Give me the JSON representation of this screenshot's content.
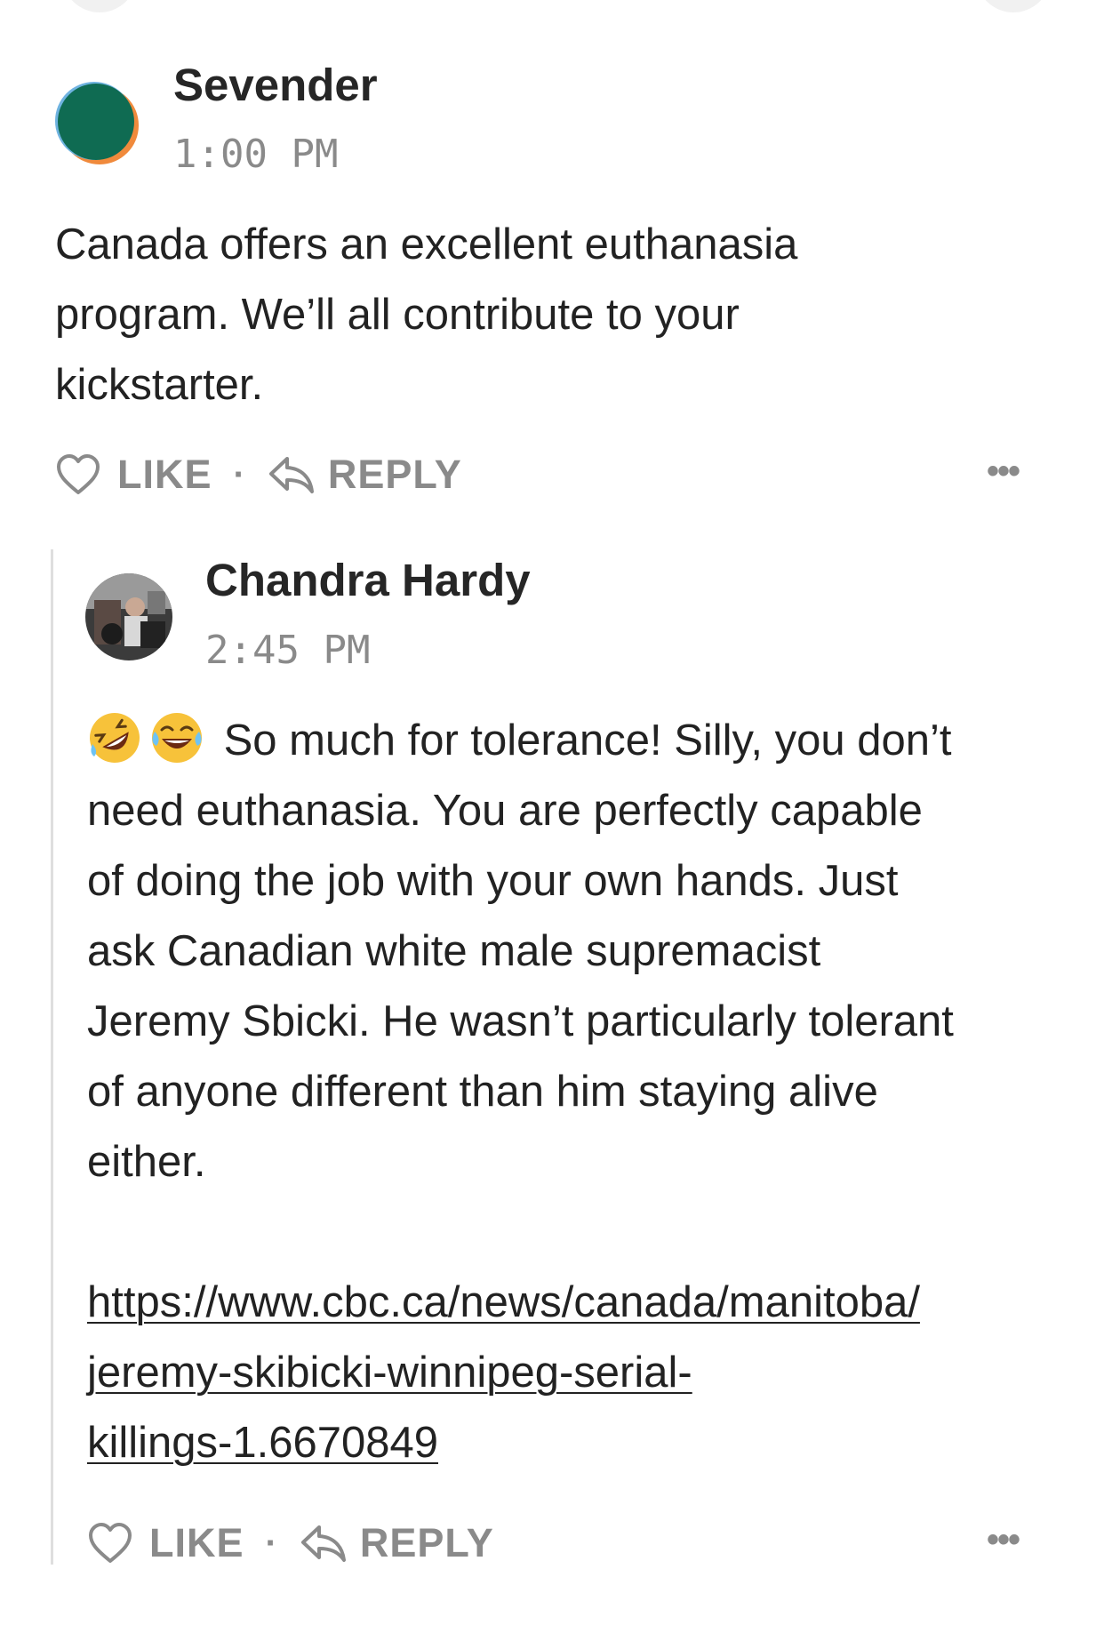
{
  "comments": [
    {
      "author": "Sevender",
      "time": "1:00 PM",
      "body_lines": [
        "Canada offers an excellent euthanasia",
        "program. We’ll all contribute to your",
        "kickstarter."
      ],
      "like_label": "LIKE",
      "reply_label": "REPLY",
      "more_label": "•••"
    },
    {
      "author": "Chandra Hardy",
      "time": "2:45 PM",
      "emoji_names": [
        "rolling-on-floor-laughing-emoji",
        "tears-of-joy-emoji"
      ],
      "body_lines": [
        "So much for tolerance! Silly, you don’t",
        "need euthanasia. You are perfectly capable",
        "of doing the job with your own hands. Just",
        "ask Canadian white male supremacist",
        "Jeremy Sbicki. He wasn’t particularly tolerant",
        "of anyone different than him staying alive",
        "either."
      ],
      "link_lines": [
        "https://www.cbc.ca/news/canada/manitoba/",
        "jeremy-skibicki-winnipeg-serial-",
        "killings-1.6670849"
      ],
      "like_label": "LIKE",
      "reply_label": "REPLY",
      "more_label": "•••"
    }
  ],
  "colors": {
    "text": "#222222",
    "muted": "#8a8a8a",
    "thread_line": "#dedede",
    "avatar_green": "#0f6b52",
    "avatar_orange": "#f08a3c"
  }
}
